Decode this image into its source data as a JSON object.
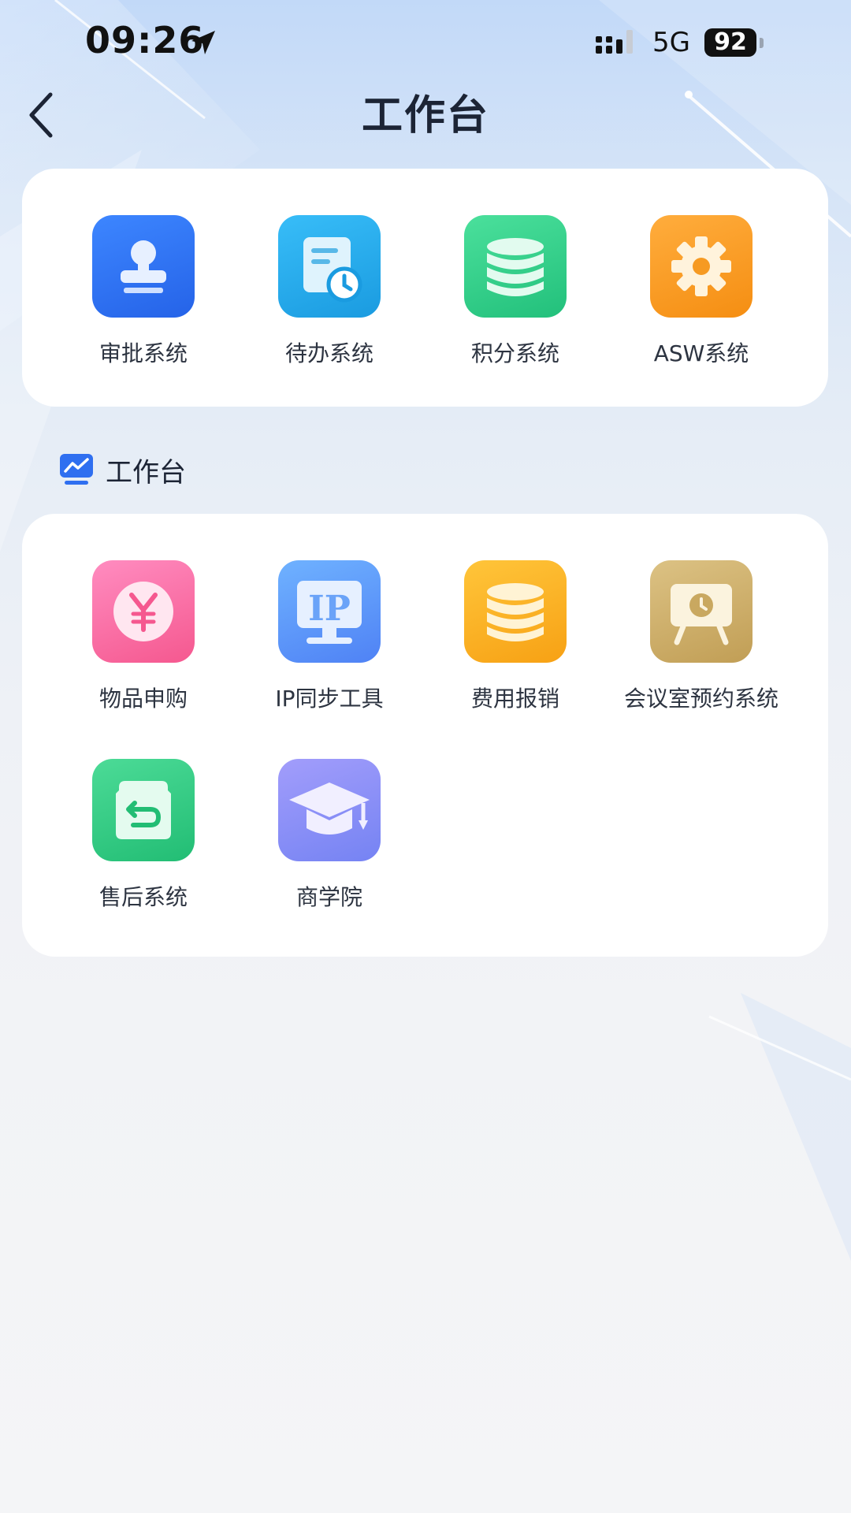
{
  "status_bar": {
    "time": "09:26",
    "network": "5G",
    "battery": "92"
  },
  "nav": {
    "title": "工作台",
    "back_icon": "chevron-left-icon"
  },
  "top_apps": [
    {
      "label": "审批系统",
      "icon": "stamp-icon",
      "color": "#2f6ff0"
    },
    {
      "label": "待办系统",
      "icon": "document-clock-icon",
      "color": "#1fa5e6"
    },
    {
      "label": "积分系统",
      "icon": "database-icon",
      "color": "#2fd08c"
    },
    {
      "label": "ASW系统",
      "icon": "gear-icon",
      "color": "#f6991f"
    }
  ],
  "section": {
    "title": "工作台",
    "icon": "chart-monitor-icon"
  },
  "work_apps": [
    {
      "label": "物品申购",
      "icon": "yen-coin-icon",
      "color": "#f9679b"
    },
    {
      "label": "IP同步工具",
      "icon": "ip-monitor-icon",
      "color": "#5c97f7"
    },
    {
      "label": "费用报销",
      "icon": "coin-stack-icon",
      "color": "#f8ab1e"
    },
    {
      "label": "会议室预约系统",
      "icon": "presentation-board-icon",
      "color": "#caa85d"
    },
    {
      "label": "售后系统",
      "icon": "return-box-icon",
      "color": "#2ecb84"
    },
    {
      "label": "商学院",
      "icon": "graduation-cap-icon",
      "color": "#7c82f3"
    }
  ]
}
